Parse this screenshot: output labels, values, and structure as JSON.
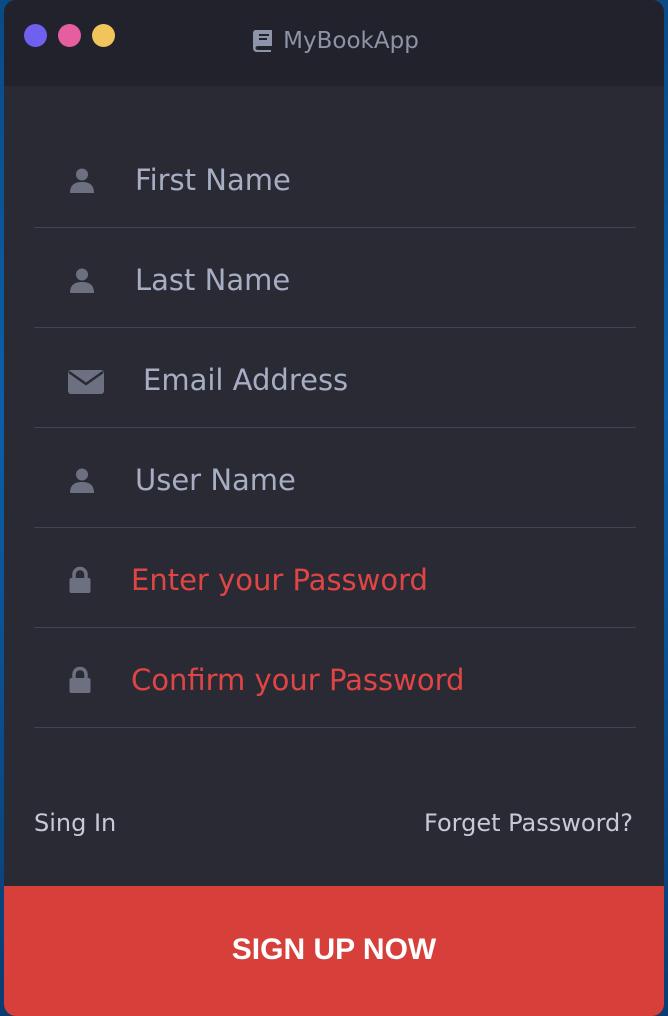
{
  "app": {
    "title": "MyBookApp"
  },
  "colors": {
    "close": "#7060f0",
    "minimize": "#e75ea0",
    "maximize": "#f2c45c",
    "placeholder": "#a7adc2",
    "password_placeholder": "#e04545",
    "icon": "#6d7080",
    "accent": "#d63f3a"
  },
  "form": {
    "fields": [
      {
        "icon": "user-icon",
        "placeholder": "First Name"
      },
      {
        "icon": "user-icon",
        "placeholder": "Last Name"
      },
      {
        "icon": "envelope-icon",
        "placeholder": "Email Address"
      },
      {
        "icon": "user-icon",
        "placeholder": "User Name"
      },
      {
        "icon": "lock-icon",
        "placeholder": "Enter your Password"
      },
      {
        "icon": "lock-icon",
        "placeholder": "Confirm your Password"
      }
    ]
  },
  "links": {
    "sign_in": "Sing In",
    "forget_password": "Forget Password?"
  },
  "actions": {
    "signup_label": "SIGN UP NOW"
  }
}
